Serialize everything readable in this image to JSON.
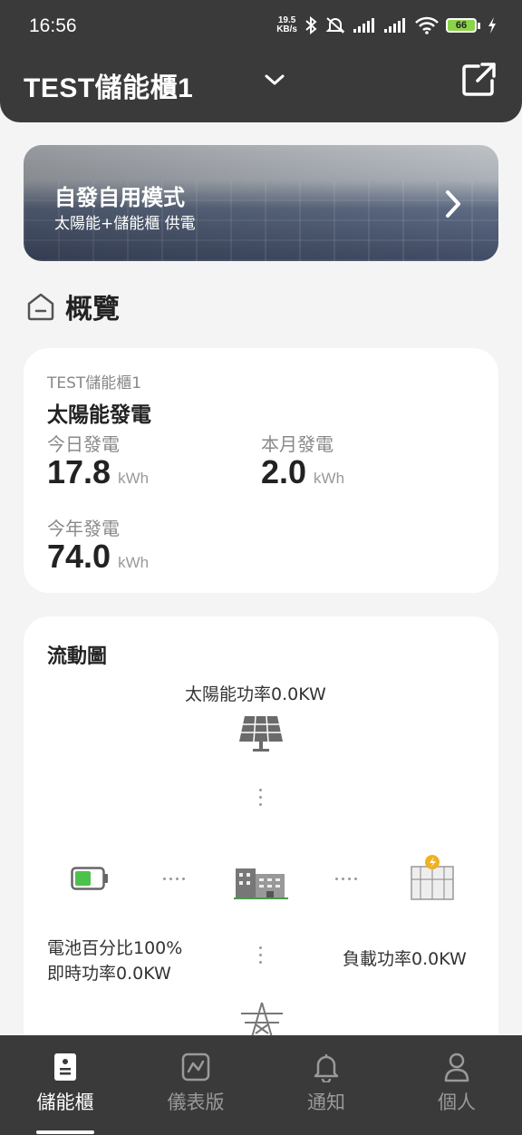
{
  "status_bar": {
    "time": "16:56",
    "net_speed_value": "19.5",
    "net_speed_unit": "KB/s",
    "battery_level": "66"
  },
  "header": {
    "title": "TEST儲能櫃1"
  },
  "mode_banner": {
    "title": "自發自用模式",
    "subtitle": "太陽能+儲能櫃 供電"
  },
  "overview": {
    "section_title": "概覽",
    "site_name": "TEST儲能櫃1",
    "heading": "太陽能發電",
    "stats": [
      {
        "label": "今日發電",
        "value": "17.8",
        "unit": "kWh"
      },
      {
        "label": "本月發電",
        "value": "2.0",
        "unit": "kWh"
      },
      {
        "label": "今年發電",
        "value": "74.0",
        "unit": "kWh"
      }
    ]
  },
  "flow": {
    "title": "流動圖",
    "solar_power": "太陽能功率0.0KW",
    "battery_percent": "電池百分比100%",
    "battery_power": "即時功率0.0KW",
    "load_power": "負載功率0.0KW"
  },
  "tabbar": {
    "items": [
      {
        "label": "儲能櫃",
        "active": true
      },
      {
        "label": "儀表版",
        "active": false
      },
      {
        "label": "通知",
        "active": false
      },
      {
        "label": "個人",
        "active": false
      }
    ]
  },
  "colors": {
    "header_bg": "#3a3a3a",
    "battery_green": "#4cc24c",
    "page_bg": "#f4f4f4"
  }
}
